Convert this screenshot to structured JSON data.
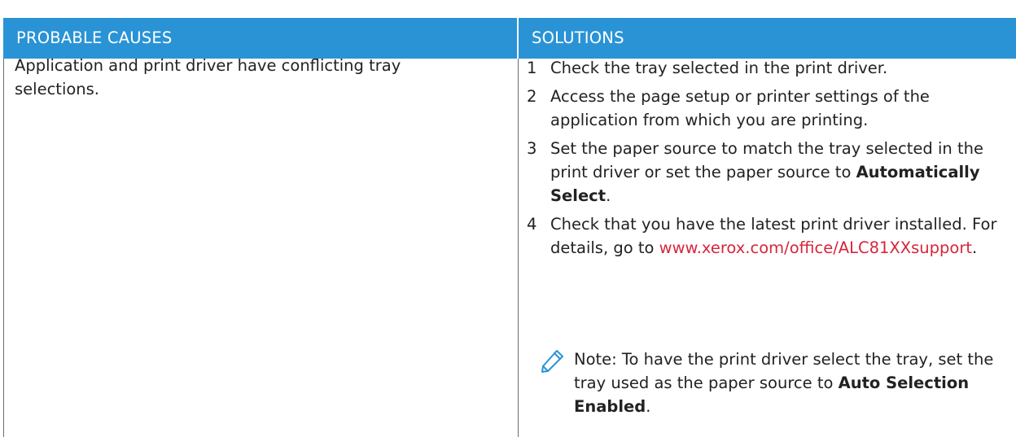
{
  "headers": {
    "causes": "PROBABLE CAUSES",
    "solutions": "SOLUTIONS"
  },
  "cause": "Application and print driver have conflicting tray selections.",
  "steps": [
    {
      "num": "1",
      "text": "Check the tray selected in the print driver."
    },
    {
      "num": "2",
      "text": "Access the page setup or printer settings of the application from which you are printing."
    },
    {
      "num": "3",
      "text_before": "Set the paper source to match the tray selected in the print driver or set the paper source to ",
      "bold": "Automatically Select",
      "text_after": "."
    },
    {
      "num": "4",
      "text_before": "Check that you have the latest print driver installed. For details, go to ",
      "link": "www.xerox.com/office/ALC81XXsupport",
      "text_after": "."
    }
  ],
  "note": {
    "icon": "pencil-icon",
    "text_before": "Note: To have the print driver select the tray, set the tray used as the paper source to ",
    "bold": "Auto Selection Enabled",
    "text_after": "."
  },
  "colors": {
    "header_bg": "#2a93d5",
    "link": "#d6263c",
    "note_icon": "#2a93d5"
  }
}
